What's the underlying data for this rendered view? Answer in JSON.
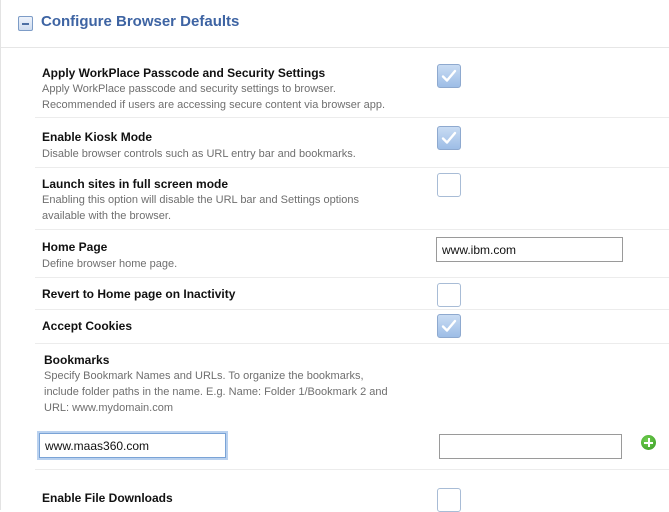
{
  "section": {
    "title": "Configure Browser Defaults"
  },
  "settings": {
    "passcode": {
      "label": "Apply WorkPlace Passcode and Security Settings",
      "desc1": "Apply WorkPlace passcode and security settings to browser.",
      "desc2": "Recommended if users are accessing secure content via browser app.",
      "checked": true
    },
    "kiosk": {
      "label": "Enable Kiosk Mode",
      "desc1": "Disable browser controls such as URL entry bar and bookmarks.",
      "checked": true
    },
    "fullscreen": {
      "label": "Launch sites in full screen mode",
      "desc1": "Enabling this option will disable the URL bar and Settings options",
      "desc2": "available with the browser.",
      "checked": false
    },
    "homepage": {
      "label": "Home Page",
      "desc1": "Define browser home page.",
      "value": "www.ibm.com"
    },
    "revert": {
      "label": "Revert to Home page on Inactivity",
      "checked": false
    },
    "cookies": {
      "label": "Accept Cookies",
      "checked": true
    },
    "bookmarks": {
      "label": "Bookmarks",
      "desc1": "Specify Bookmark Names and URLs. To organize the bookmarks,",
      "desc2": "include folder paths in the name. E.g. Name: Folder 1/Bookmark 2 and",
      "desc3": "URL: www.mydomain.com",
      "name_value": "www.maas360.com",
      "url_value": ""
    },
    "downloads": {
      "label": "Enable File Downloads",
      "checked": false
    }
  },
  "icons": {
    "collapse": "minus-collapse-icon",
    "check": "checkmark-icon",
    "add": "plus-circle-icon"
  },
  "colors": {
    "title": "#3e64a3",
    "checked_fill": "#9dbde6",
    "add_green": "#3b9a26"
  }
}
